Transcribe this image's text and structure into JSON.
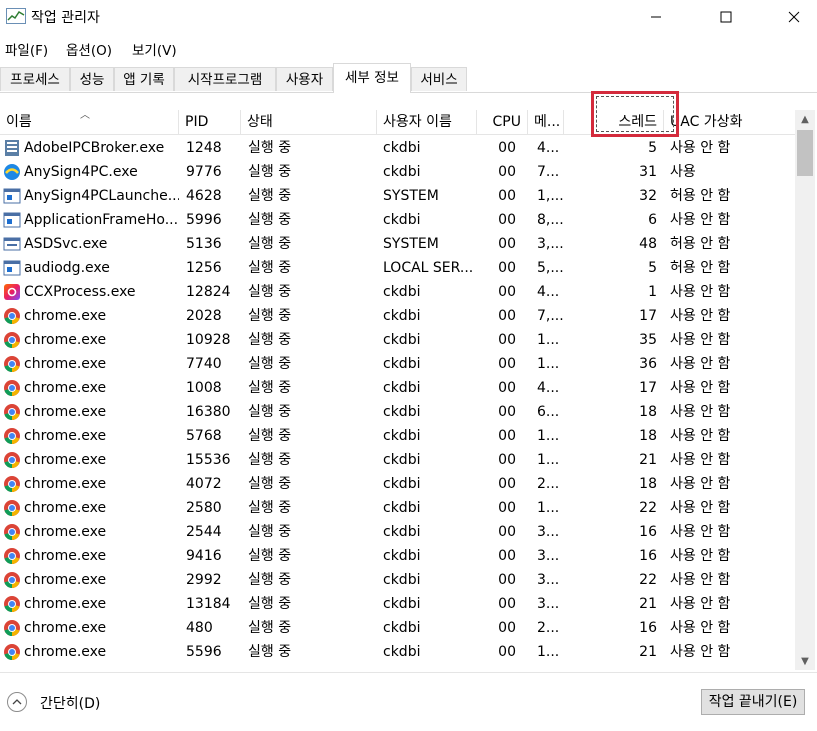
{
  "window": {
    "title": "작업 관리자"
  },
  "menu": [
    "파일(F)",
    "옵션(O)",
    "보기(V)"
  ],
  "tabs": [
    "프로세스",
    "성능",
    "앱 기록",
    "시작프로그램",
    "사용자",
    "세부 정보",
    "서비스"
  ],
  "active_tab": "세부 정보",
  "columns": [
    "이름",
    "PID",
    "상태",
    "사용자 이름",
    "CPU",
    "메...",
    "스레드",
    "UAC 가상화"
  ],
  "rows": [
    {
      "name": "AdobeIPCBroker.exe",
      "pid": "1248",
      "status": "실행 중",
      "user": "ckdbi",
      "cpu": "00",
      "mem": "4...",
      "threads": "5",
      "uac": "사용 안 함",
      "icon": "adobe-ipc-icon"
    },
    {
      "name": "AnySign4PC.exe",
      "pid": "9776",
      "status": "실행 중",
      "user": "ckdbi",
      "cpu": "00",
      "mem": "7...",
      "threads": "31",
      "uac": "사용",
      "icon": "anysign-icon"
    },
    {
      "name": "AnySign4PCLaunche...",
      "pid": "4628",
      "status": "실행 중",
      "user": "SYSTEM",
      "cpu": "00",
      "mem": "1,...",
      "threads": "32",
      "uac": "허용 안 함",
      "icon": "window-app-icon"
    },
    {
      "name": "ApplicationFrameHo...",
      "pid": "5996",
      "status": "실행 중",
      "user": "ckdbi",
      "cpu": "00",
      "mem": "8,...",
      "threads": "6",
      "uac": "사용 안 함",
      "icon": "window-app-icon"
    },
    {
      "name": "ASDSvc.exe",
      "pid": "5136",
      "status": "실행 중",
      "user": "SYSTEM",
      "cpu": "00",
      "mem": "3,...",
      "threads": "48",
      "uac": "허용 안 함",
      "icon": "service-app-icon"
    },
    {
      "name": "audiodg.exe",
      "pid": "1256",
      "status": "실행 중",
      "user": "LOCAL SER...",
      "cpu": "00",
      "mem": "5,...",
      "threads": "5",
      "uac": "허용 안 함",
      "icon": "window-app-icon"
    },
    {
      "name": "CCXProcess.exe",
      "pid": "12824",
      "status": "실행 중",
      "user": "ckdbi",
      "cpu": "00",
      "mem": "4...",
      "threads": "1",
      "uac": "사용 안 함",
      "icon": "creative-cloud-icon"
    },
    {
      "name": "chrome.exe",
      "pid": "2028",
      "status": "실행 중",
      "user": "ckdbi",
      "cpu": "00",
      "mem": "7,...",
      "threads": "17",
      "uac": "사용 안 함",
      "icon": "chrome-icon"
    },
    {
      "name": "chrome.exe",
      "pid": "10928",
      "status": "실행 중",
      "user": "ckdbi",
      "cpu": "00",
      "mem": "1...",
      "threads": "35",
      "uac": "사용 안 함",
      "icon": "chrome-icon"
    },
    {
      "name": "chrome.exe",
      "pid": "7740",
      "status": "실행 중",
      "user": "ckdbi",
      "cpu": "00",
      "mem": "1...",
      "threads": "36",
      "uac": "사용 안 함",
      "icon": "chrome-icon"
    },
    {
      "name": "chrome.exe",
      "pid": "1008",
      "status": "실행 중",
      "user": "ckdbi",
      "cpu": "00",
      "mem": "4...",
      "threads": "17",
      "uac": "사용 안 함",
      "icon": "chrome-icon"
    },
    {
      "name": "chrome.exe",
      "pid": "16380",
      "status": "실행 중",
      "user": "ckdbi",
      "cpu": "00",
      "mem": "6...",
      "threads": "18",
      "uac": "사용 안 함",
      "icon": "chrome-icon"
    },
    {
      "name": "chrome.exe",
      "pid": "5768",
      "status": "실행 중",
      "user": "ckdbi",
      "cpu": "00",
      "mem": "1...",
      "threads": "18",
      "uac": "사용 안 함",
      "icon": "chrome-icon"
    },
    {
      "name": "chrome.exe",
      "pid": "15536",
      "status": "실행 중",
      "user": "ckdbi",
      "cpu": "00",
      "mem": "1...",
      "threads": "21",
      "uac": "사용 안 함",
      "icon": "chrome-icon"
    },
    {
      "name": "chrome.exe",
      "pid": "4072",
      "status": "실행 중",
      "user": "ckdbi",
      "cpu": "00",
      "mem": "2...",
      "threads": "18",
      "uac": "사용 안 함",
      "icon": "chrome-icon"
    },
    {
      "name": "chrome.exe",
      "pid": "2580",
      "status": "실행 중",
      "user": "ckdbi",
      "cpu": "00",
      "mem": "1...",
      "threads": "22",
      "uac": "사용 안 함",
      "icon": "chrome-icon"
    },
    {
      "name": "chrome.exe",
      "pid": "2544",
      "status": "실행 중",
      "user": "ckdbi",
      "cpu": "00",
      "mem": "3...",
      "threads": "16",
      "uac": "사용 안 함",
      "icon": "chrome-icon"
    },
    {
      "name": "chrome.exe",
      "pid": "9416",
      "status": "실행 중",
      "user": "ckdbi",
      "cpu": "00",
      "mem": "3...",
      "threads": "16",
      "uac": "사용 안 함",
      "icon": "chrome-icon"
    },
    {
      "name": "chrome.exe",
      "pid": "2992",
      "status": "실행 중",
      "user": "ckdbi",
      "cpu": "00",
      "mem": "3...",
      "threads": "22",
      "uac": "사용 안 함",
      "icon": "chrome-icon"
    },
    {
      "name": "chrome.exe",
      "pid": "13184",
      "status": "실행 중",
      "user": "ckdbi",
      "cpu": "00",
      "mem": "3...",
      "threads": "21",
      "uac": "사용 안 함",
      "icon": "chrome-icon"
    },
    {
      "name": "chrome.exe",
      "pid": "480",
      "status": "실행 중",
      "user": "ckdbi",
      "cpu": "00",
      "mem": "2...",
      "threads": "16",
      "uac": "사용 안 함",
      "icon": "chrome-icon"
    },
    {
      "name": "chrome.exe",
      "pid": "5596",
      "status": "실행 중",
      "user": "ckdbi",
      "cpu": "00",
      "mem": "1...",
      "threads": "21",
      "uac": "사용 안 함",
      "icon": "chrome-icon"
    }
  ],
  "footer": {
    "collapse_label": "간단히(D)",
    "end_task_label": "작업 끝내기(E)"
  },
  "colors": {
    "highlight": "#d42b3c",
    "chrome_red": "#db4437",
    "chrome_green": "#0f9d58",
    "chrome_yellow": "#f4b400",
    "chrome_blue": "#4285f4"
  }
}
